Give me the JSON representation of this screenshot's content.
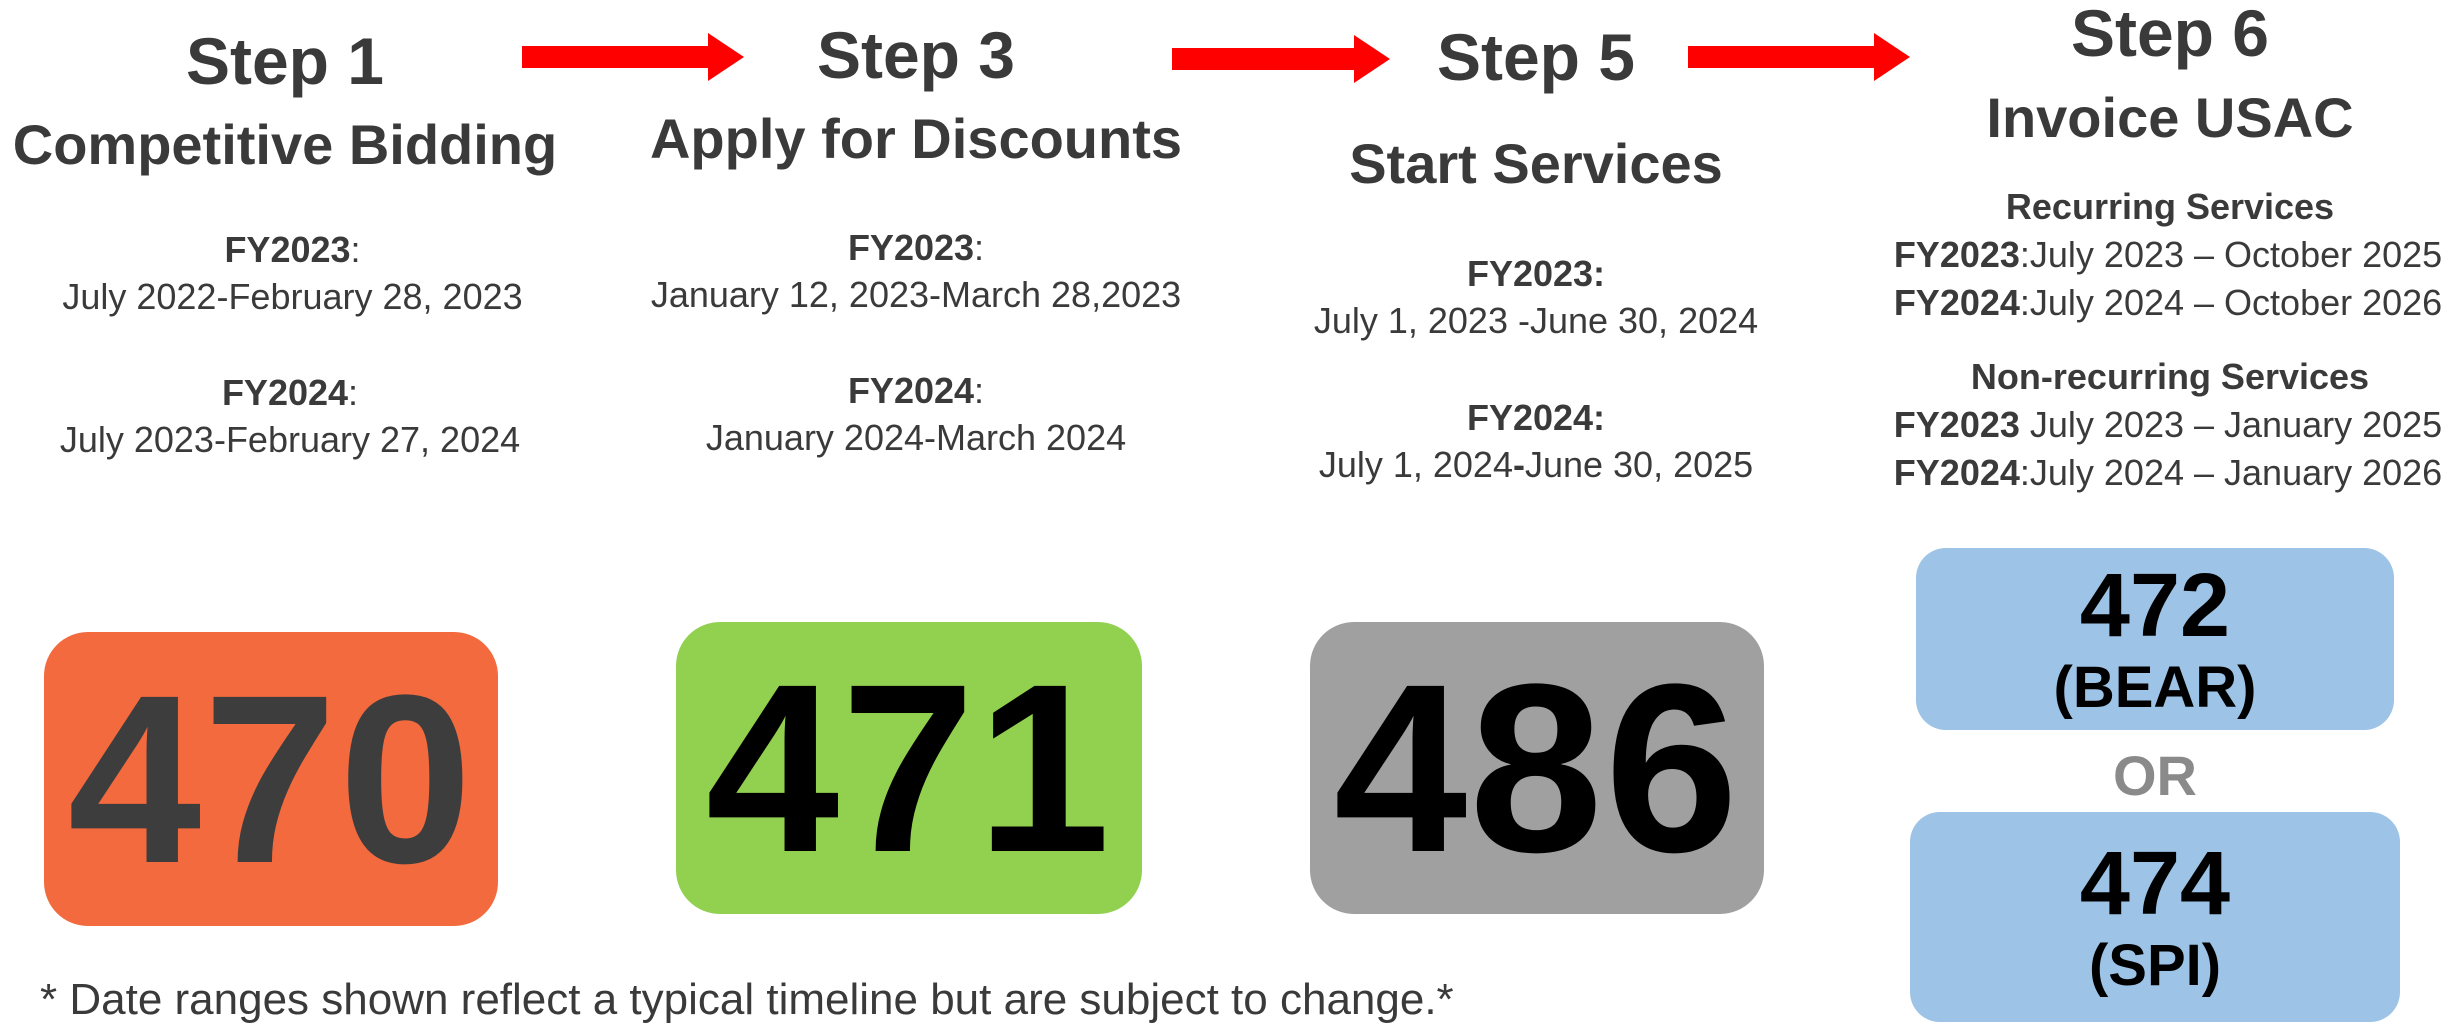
{
  "steps": {
    "step1": {
      "title": "Step 1",
      "subtitle": "Competitive Bidding",
      "fy2023_label": "FY2023",
      "fy2023_sep": ":",
      "fy2023_range": "July 2022-February 28, 2023",
      "fy2024_label": "FY2024",
      "fy2024_sep": ":",
      "fy2024_range": "July 2023-February 27, 2024"
    },
    "step3": {
      "title": "Step 3",
      "subtitle": "Apply for Discounts",
      "fy2023_label": "FY2023",
      "fy2023_sep": ":",
      "fy2023_range": "January 12, 2023-March 28,2023",
      "fy2024_label": "FY2024",
      "fy2024_sep": ":",
      "fy2024_range": "January 2024-March  2024"
    },
    "step5": {
      "title": "Step 5",
      "subtitle": "Start Services",
      "fy2023_label": "FY2023:",
      "fy2023_range": "July 1, 2023 -June 30, 2024",
      "fy2024_label": "FY2024:",
      "fy2024_range_a": "July 1, 2024",
      "fy2024_range_dash": "-",
      "fy2024_range_b": "June 30, 2025"
    },
    "step6": {
      "title": "Step 6",
      "subtitle": "Invoice USAC",
      "recurring_heading": "Recurring Services",
      "recurring_fy2023_label": "FY2023",
      "recurring_fy2023_range": ":July 2023 – October 2025",
      "recurring_fy2024_label": "FY2024",
      "recurring_fy2024_range": ":July 2024 – October 2026",
      "nonrecurring_heading": "Non-recurring Services",
      "nonrecurring_fy2023_label": "FY2023",
      "nonrecurring_fy2023_range": " July 2023 – January 2025",
      "nonrecurring_fy2024_label": "FY2024",
      "nonrecurring_fy2024_range": ":July 2024 – January 2026"
    }
  },
  "forms": {
    "form470": {
      "number": "470",
      "color": "#f26a3d",
      "text_color": "#3d3d3d"
    },
    "form471": {
      "number": "471",
      "color": "#92d050",
      "text_color": "#000000"
    },
    "form486": {
      "number": "486",
      "color": "#a0a0a0",
      "text_color": "#000000"
    },
    "form472": {
      "number": "472",
      "label": "(BEAR)",
      "color": "#9dc3e6"
    },
    "or_text": "OR",
    "form474": {
      "number": "474",
      "label": "(SPI)",
      "color": "#9dc3e6"
    }
  },
  "arrows": {
    "color": "#ff0000"
  },
  "footnote": "* Date ranges shown reflect a typical timeline but are subject to change.*",
  "icons": [
    "right-arrow-icon"
  ]
}
